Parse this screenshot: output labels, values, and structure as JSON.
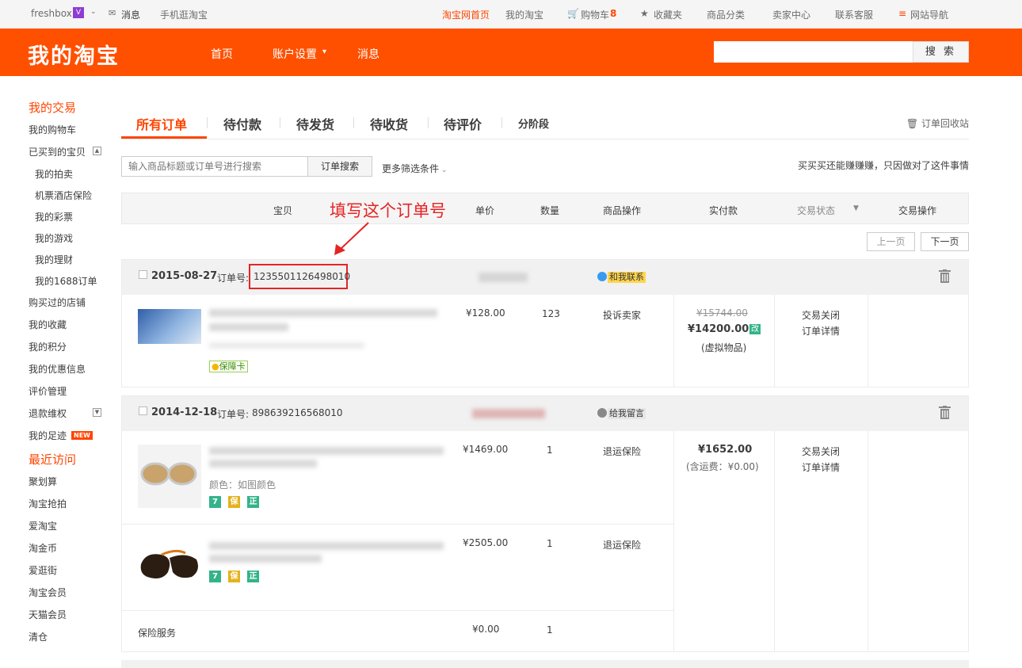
{
  "topbar": {
    "user": "freshbox",
    "messages": "消息",
    "mobile": "手机逛淘宝",
    "home": "淘宝网首页",
    "mytaobao": "我的淘宝",
    "cart": "购物车",
    "cart_count": "8",
    "favorites": "收藏夹",
    "categories": "商品分类",
    "seller": "卖家中心",
    "service": "联系客服",
    "sitenav": "网站导航"
  },
  "header": {
    "logo": "我的淘宝",
    "nav_home": "首页",
    "nav_account": "账户设置",
    "nav_msg": "消息",
    "search_btn": "搜 索"
  },
  "sidebar": {
    "my_trade": "我的交易",
    "items": [
      "我的购物车",
      "已买到的宝贝"
    ],
    "subitems": [
      "我的拍卖",
      "机票酒店保险",
      "我的彩票",
      "我的游戏",
      "我的理财",
      "我的1688订单"
    ],
    "items2": [
      "购买过的店铺",
      "我的收藏",
      "我的积分",
      "我的优惠信息",
      "评价管理",
      "退款维权",
      "我的足迹"
    ],
    "new_badge": "NEW",
    "recent": "最近访问",
    "recent_items": [
      "聚划算",
      "淘宝抢拍",
      "爱淘宝",
      "淘金币",
      "爱逛街",
      "淘宝会员",
      "天猫会员",
      "清仓"
    ]
  },
  "tabs": {
    "all": "所有订单",
    "unpaid": "待付款",
    "unshipped": "待发货",
    "unreceived": "待收货",
    "unrated": "待评价",
    "stage": "分阶段",
    "recycle": "订单回收站"
  },
  "search": {
    "placeholder": "输入商品标题或订单号进行搜索",
    "btn": "订单搜索",
    "more": "更多筛选条件",
    "slogan": "买买买还能赚赚赚，只因做对了这件事情"
  },
  "table": {
    "col_item": "宝贝",
    "col_price": "单价",
    "col_qty": "数量",
    "col_ops": "商品操作",
    "col_paid": "实付款",
    "col_status": "交易状态",
    "col_actions": "交易操作"
  },
  "annotation": "填写这个订单号",
  "pager": {
    "prev": "上一页",
    "next": "下一页"
  },
  "orders": [
    {
      "date": "2015-08-27",
      "order_label": "订单号:",
      "order_no": "1235501126498010",
      "contact": "和我联系",
      "price": "¥128.00",
      "qty": "123",
      "op": "投诉卖家",
      "orig_total": "¥15744.00",
      "total": "¥14200.00",
      "total_tag": "改",
      "note": "(虚拟物品)",
      "status": "交易关闭",
      "detail": "订单详情",
      "guarantee": "保障卡"
    },
    {
      "date": "2014-12-18",
      "order_label": "订单号:",
      "order_no": "898639216568010",
      "contact": "给我留言",
      "items": [
        {
          "price": "¥1469.00",
          "qty": "1",
          "op": "退运保险",
          "color": "颜色：如图颜色"
        },
        {
          "price": "¥2505.00",
          "qty": "1",
          "op": "退运保险"
        }
      ],
      "insurance": "保险服务",
      "ins_price": "¥0.00",
      "ins_qty": "1",
      "total": "¥1652.00",
      "note": "(含运费：¥0.00)",
      "status": "交易关闭",
      "detail": "订单详情",
      "icons": [
        "7",
        "保",
        "正"
      ]
    }
  ]
}
